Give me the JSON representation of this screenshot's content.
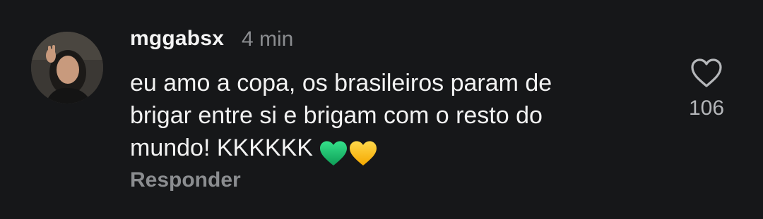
{
  "comment": {
    "username": "mggabsx",
    "timestamp": "4 min",
    "text_lines": [
      "eu amo a copa, os brasileiros param de",
      "brigar entre si e brigam com o resto do",
      "mundo! KKKKKK"
    ],
    "emojis": [
      "green-heart-icon",
      "yellow-heart-icon"
    ],
    "reply_label": "Responder",
    "like_icon": "heart-outline-icon",
    "like_count": "106"
  },
  "colors": {
    "background": "#161719",
    "text_primary": "#f2f2f2",
    "text_secondary": "#8b8d90",
    "green_heart": "#1fcf73",
    "yellow_heart": "#ffc21a"
  }
}
